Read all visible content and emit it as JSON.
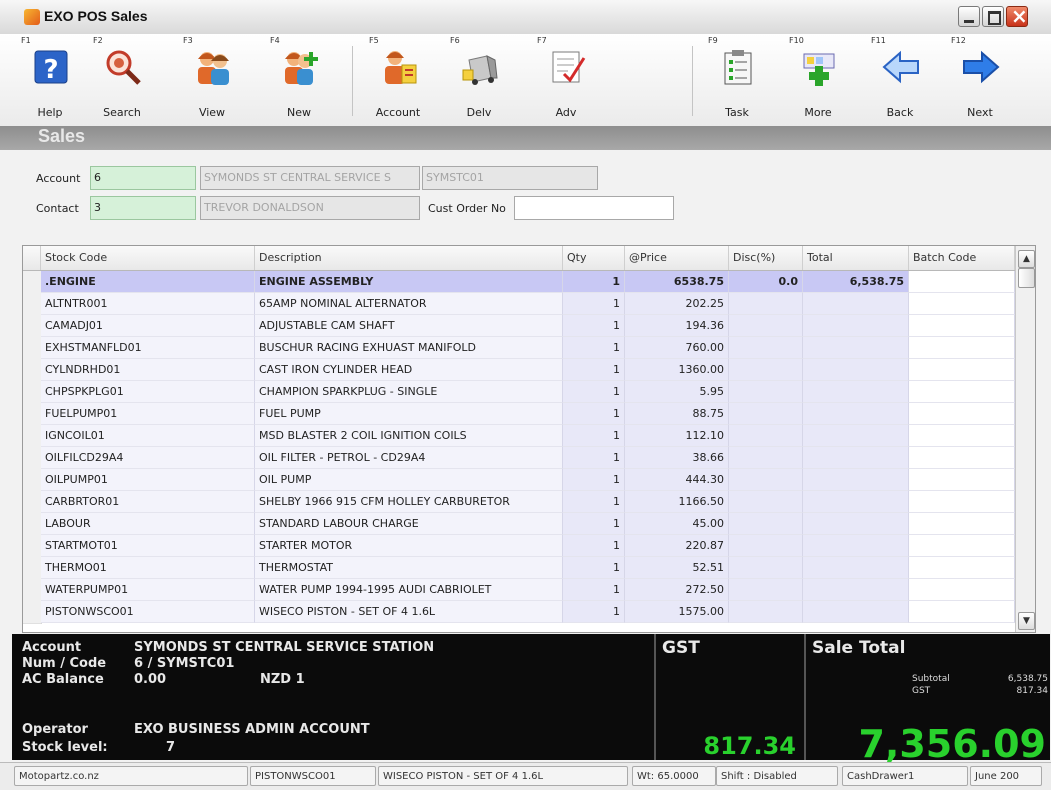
{
  "window": {
    "title": "EXO POS Sales"
  },
  "toolbar": [
    {
      "fkey": "F1",
      "label": "Help",
      "icon": "help-icon"
    },
    {
      "fkey": "F2",
      "label": "Search",
      "icon": "search-icon"
    },
    {
      "fkey": "F3",
      "label": "View",
      "icon": "view-people-icon"
    },
    {
      "fkey": "F4",
      "label": "New",
      "icon": "new-person-icon"
    },
    {
      "fkey": "F5",
      "label": "Account",
      "icon": "account-icon"
    },
    {
      "fkey": "F6",
      "label": "Delv",
      "icon": "delivery-truck-icon"
    },
    {
      "fkey": "F7",
      "label": "Adv",
      "icon": "advanced-edit-icon"
    },
    {
      "fkey": "F9",
      "label": "Task",
      "icon": "task-clipboard-icon"
    },
    {
      "fkey": "F10",
      "label": "More",
      "icon": "more-add-icon"
    },
    {
      "fkey": "F11",
      "label": "Back",
      "icon": "back-arrow-icon"
    },
    {
      "fkey": "F12",
      "label": "Next",
      "icon": "next-arrow-icon"
    }
  ],
  "section_title": "Sales",
  "form": {
    "account_label": "Account",
    "account_value": "6",
    "account_name": "SYMONDS ST CENTRAL SERVICE S",
    "account_code": "SYMSTC01",
    "contact_label": "Contact",
    "contact_value": "3",
    "contact_name": "TREVOR DONALDSON",
    "cust_order_label": "Cust Order No",
    "cust_order_value": ""
  },
  "grid": {
    "columns": [
      "Stock Code",
      "Description",
      "Qty",
      "@Price",
      "Disc(%)",
      "Total",
      "Batch Code"
    ],
    "rows": [
      {
        "code": ".ENGINE",
        "desc": "ENGINE ASSEMBLY",
        "qty": "1",
        "price": "6538.75",
        "disc": "0.0",
        "total": "6,538.75",
        "batch": ""
      },
      {
        "code": "ALTNTR001",
        "desc": "65AMP NOMINAL ALTERNATOR",
        "qty": "1",
        "price": "202.25",
        "disc": "",
        "total": "",
        "batch": ""
      },
      {
        "code": "CAMADJ01",
        "desc": "ADJUSTABLE CAM SHAFT",
        "qty": "1",
        "price": "194.36",
        "disc": "",
        "total": "",
        "batch": ""
      },
      {
        "code": "EXHSTMANFLD01",
        "desc": "BUSCHUR RACING EXHUAST MANIFOLD",
        "qty": "1",
        "price": "760.00",
        "disc": "",
        "total": "",
        "batch": ""
      },
      {
        "code": "CYLNDRHD01",
        "desc": "CAST IRON CYLINDER HEAD",
        "qty": "1",
        "price": "1360.00",
        "disc": "",
        "total": "",
        "batch": ""
      },
      {
        "code": "CHPSPKPLG01",
        "desc": "CHAMPION SPARKPLUG - SINGLE",
        "qty": "1",
        "price": "5.95",
        "disc": "",
        "total": "",
        "batch": ""
      },
      {
        "code": "FUELPUMP01",
        "desc": "FUEL PUMP",
        "qty": "1",
        "price": "88.75",
        "disc": "",
        "total": "",
        "batch": ""
      },
      {
        "code": "IGNCOIL01",
        "desc": "MSD BLASTER 2 COIL IGNITION COILS",
        "qty": "1",
        "price": "112.10",
        "disc": "",
        "total": "",
        "batch": ""
      },
      {
        "code": "OILFILCD29A4",
        "desc": "OIL FILTER - PETROL - CD29A4",
        "qty": "1",
        "price": "38.66",
        "disc": "",
        "total": "",
        "batch": ""
      },
      {
        "code": "OILPUMP01",
        "desc": "OIL PUMP",
        "qty": "1",
        "price": "444.30",
        "disc": "",
        "total": "",
        "batch": ""
      },
      {
        "code": "CARBRTOR01",
        "desc": "SHELBY 1966 915 CFM HOLLEY CARBURETOR",
        "qty": "1",
        "price": "1166.50",
        "disc": "",
        "total": "",
        "batch": ""
      },
      {
        "code": "LABOUR",
        "desc": "STANDARD LABOUR CHARGE",
        "qty": "1",
        "price": "45.00",
        "disc": "",
        "total": "",
        "batch": ""
      },
      {
        "code": "STARTMOT01",
        "desc": "STARTER MOTOR",
        "qty": "1",
        "price": "220.87",
        "disc": "",
        "total": "",
        "batch": ""
      },
      {
        "code": "THERMO01",
        "desc": "THERMOSTAT",
        "qty": "1",
        "price": "52.51",
        "disc": "",
        "total": "",
        "batch": ""
      },
      {
        "code": "WATERPUMP01",
        "desc": "WATER PUMP 1994-1995 AUDI CABRIOLET",
        "qty": "1",
        "price": "272.50",
        "disc": "",
        "total": "",
        "batch": ""
      },
      {
        "code": "PISTONWSCO01",
        "desc": "WISECO PISTON - SET OF 4 1.6L",
        "qty": "1",
        "price": "1575.00",
        "disc": "",
        "total": "",
        "batch": ""
      }
    ]
  },
  "info": {
    "account_label": "Account",
    "account_name": "SYMONDS ST CENTRAL SERVICE STATION",
    "num_code_label": "Num / Code",
    "num_code_value": "6 / SYMSTC01",
    "balance_label": "AC Balance",
    "balance_value": "0.00",
    "currency": "NZD 1",
    "operator_label": "Operator",
    "operator_value": "EXO BUSINESS ADMIN ACCOUNT",
    "stock_label": "Stock level:",
    "stock_value": "7",
    "gst_title": "GST",
    "gst_value": "817.34",
    "sale_total_title": "Sale Total",
    "subtotal_label": "Subtotal",
    "subtotal_value": "6,538.75",
    "gst_small_label": "GST",
    "gst_small_value": "817.34",
    "sale_total_value": "7,356.09"
  },
  "statusbar": {
    "company": "Motopartz.co.nz",
    "stock_code": "PISTONWSCO01",
    "description": "WISECO PISTON - SET OF 4 1.6L",
    "weight": "Wt: 65.0000",
    "shift": "Shift : Disabled",
    "drawer": "CashDrawer1",
    "date": "June 200"
  },
  "colors": {
    "accent_green": "#29d12d",
    "selected_row": "#c8c8f4",
    "field_green": "#d6f1d9"
  }
}
